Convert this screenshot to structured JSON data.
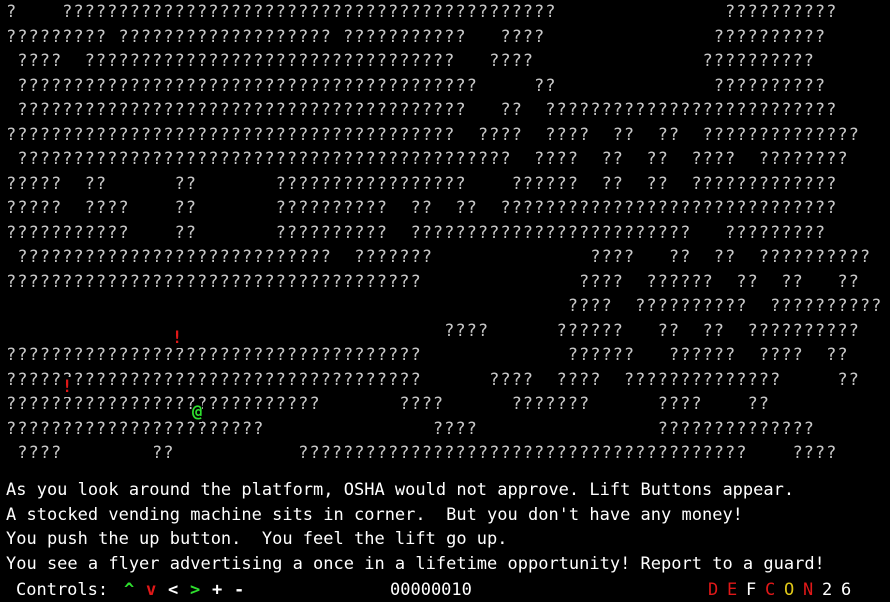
{
  "map": {
    "rows": [
      "?    ????????????????????????????????????????????               ??????????",
      "????????? ??????????????????? ???????????   ????               ??????????",
      " ????  ?????????????????????????????????   ????               ??????????",
      " ?????????????????????????????????????????     ??              ??????????",
      " ????????????????????????????????????????   ??  ??????????????????????????",
      "????????????????????????????????????????  ????  ????  ??  ??  ??????????????",
      " ????????????????????????????????????????????  ????  ??  ??  ????  ????????",
      "?????  ??      ??       ?????????????????    ??????  ??  ??  ?????????????",
      "?????  ????    ??       ??????????  ??  ??  ??????????????????????????????",
      "???????????    ??       ??????????  ?????????????????????????   ?????????",
      " ????????????????????????????  ???????              ????   ??  ??  ??????????",
      "?????????????????????????????????????              ????  ??????  ??  ??   ??",
      "                                                  ????  ??????????  ??????????",
      "                                       ????      ??????   ??  ??  ??????????",
      "?????????????????????????????????????             ??????   ??????  ????  ??",
      "?????????????????????????????????????      ????  ????  ??????????????     ??",
      "????????????????????????????       ????      ???????      ????    ??",
      "???????????????????????               ????                ??????????????",
      " ????        ??           ????????????????????????????????????????    ????"
    ],
    "markers": [
      {
        "kind": "exclaim",
        "glyph": "!"
      },
      {
        "kind": "exclaim",
        "glyph": "!"
      },
      {
        "kind": "player",
        "glyph": "@"
      }
    ]
  },
  "messages": [
    "As you look around the platform, OSHA would not approve. Lift Buttons appear.",
    "A stocked vending machine sits in corner.  But you don't have any money!",
    "You push the up button.  You feel the lift go up.",
    "You see a flyer advertising a once in a lifetime opportunity! Report to a guard!"
  ],
  "status": {
    "controls_label": "Controls:",
    "controls": [
      {
        "glyph": "^",
        "color": "#2ee02e"
      },
      {
        "glyph": "v",
        "color": "#e01818"
      },
      {
        "glyph": "<",
        "color": "#ffffff"
      },
      {
        "glyph": ">",
        "color": "#2ee02e"
      },
      {
        "glyph": "+",
        "color": "#ffffff"
      },
      {
        "glyph": "-",
        "color": "#ffffff"
      }
    ],
    "score": "00000010",
    "defcon": [
      {
        "glyph": "D",
        "color": "#e01818"
      },
      {
        "glyph": "E",
        "color": "#e01818"
      },
      {
        "glyph": "F",
        "color": "#ffffff"
      },
      {
        "glyph": "C",
        "color": "#e01818"
      },
      {
        "glyph": "O",
        "color": "#e0c818"
      },
      {
        "glyph": "N",
        "color": "#e01818"
      },
      {
        "glyph": "2",
        "color": "#ffffff"
      },
      {
        "glyph": "6",
        "color": "#ffffff"
      }
    ]
  }
}
